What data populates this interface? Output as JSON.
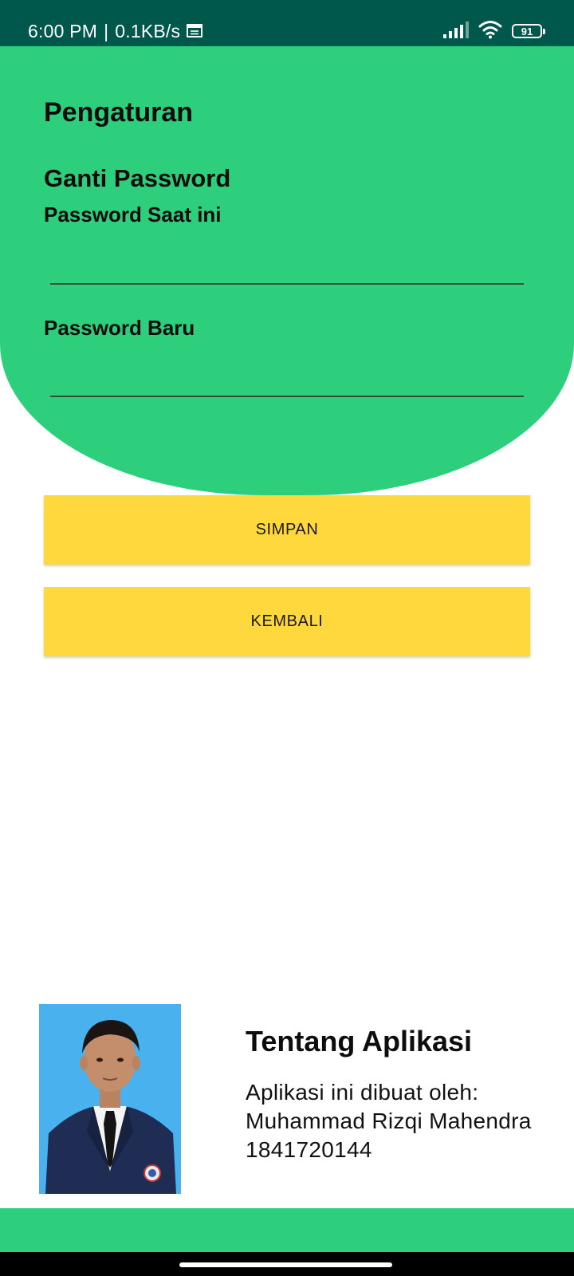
{
  "status_bar": {
    "time": "6:00 PM",
    "separator": "|",
    "speed": "0.1KB/s",
    "battery": "91"
  },
  "settings": {
    "title": "Pengaturan",
    "section_title": "Ganti Password",
    "current_password_label": "Password Saat ini",
    "current_password_value": "",
    "new_password_label": "Password Baru",
    "new_password_value": ""
  },
  "buttons": {
    "save_label": "SIMPAN",
    "back_label": "KEMBALI"
  },
  "about": {
    "title": "Tentang Aplikasi",
    "line1": "Aplikasi ini dibuat oleh:",
    "line2": "Muhammad Rizqi Mahendra",
    "line3": "1841720144"
  },
  "colors": {
    "status_bar": "#00574b",
    "primary_green": "#2ecf7c",
    "button_yellow": "#ffd83d",
    "photo_background": "#49b2ee"
  },
  "icons": [
    "calendar-icon",
    "signal-icon",
    "wifi-icon",
    "battery-icon"
  ]
}
